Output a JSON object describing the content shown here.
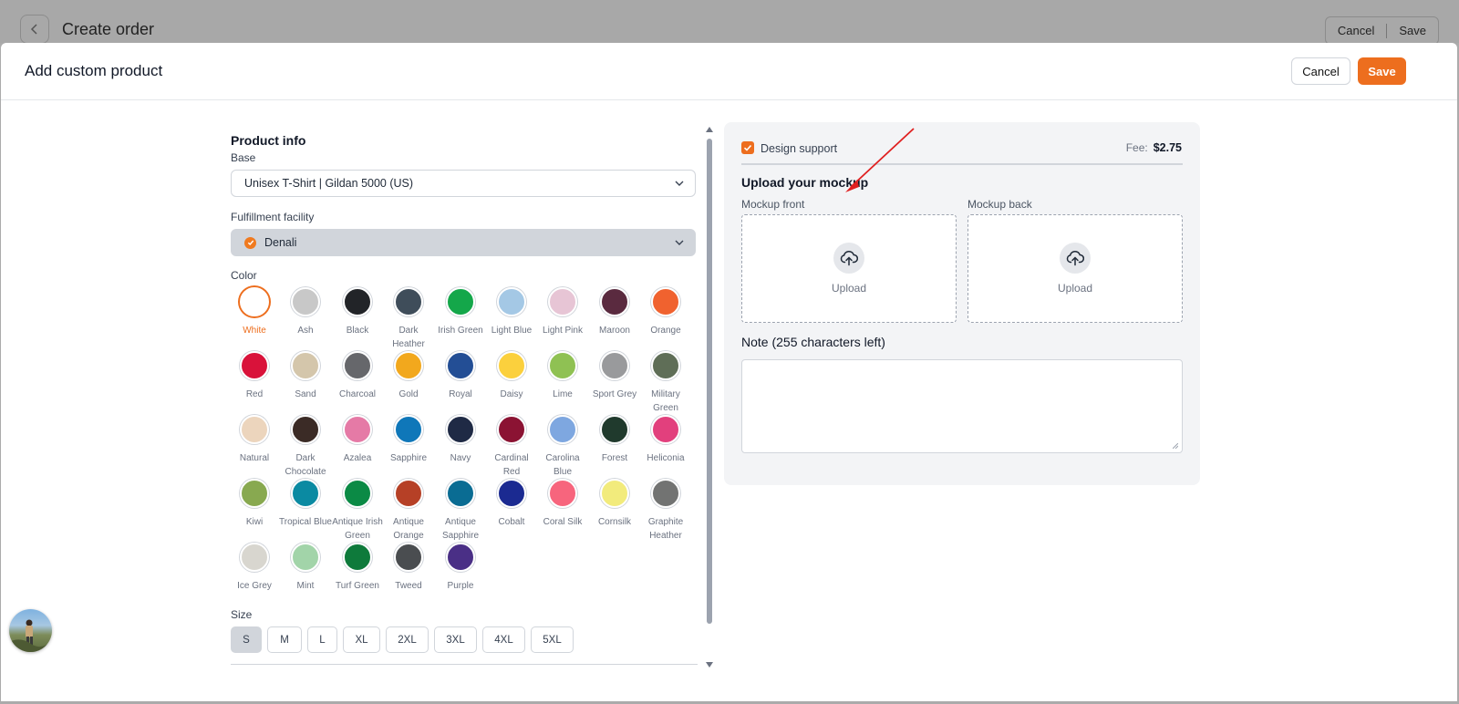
{
  "background": {
    "title": "Create order",
    "cancel_label": "Cancel",
    "save_label": "Save"
  },
  "modal": {
    "title": "Add custom product",
    "cancel_label": "Cancel",
    "save_label": "Save"
  },
  "product_info": {
    "section_title": "Product info",
    "base_label": "Base",
    "base_value": "Unisex T-Shirt | Gildan 5000 (US)",
    "facility_label": "Fulfillment facility",
    "facility_value": "Denali",
    "color_label": "Color",
    "colors": [
      {
        "name": "White",
        "hex": "#ffffff",
        "selected": true
      },
      {
        "name": "Ash",
        "hex": "#c8c8c8"
      },
      {
        "name": "Black",
        "hex": "#222428"
      },
      {
        "name": "Dark Heather",
        "hex": "#3f4d5a"
      },
      {
        "name": "Irish Green",
        "hex": "#14a74a"
      },
      {
        "name": "Light Blue",
        "hex": "#a4c8e5"
      },
      {
        "name": "Light Pink",
        "hex": "#e7c5d5"
      },
      {
        "name": "Maroon",
        "hex": "#5a2a3f"
      },
      {
        "name": "Orange",
        "hex": "#f0622f"
      },
      {
        "name": "Red",
        "hex": "#d9123a"
      },
      {
        "name": "Sand",
        "hex": "#d4c6ab"
      },
      {
        "name": "Charcoal",
        "hex": "#66676b"
      },
      {
        "name": "Gold",
        "hex": "#f2a81d"
      },
      {
        "name": "Royal",
        "hex": "#234e95"
      },
      {
        "name": "Daisy",
        "hex": "#fbd03d"
      },
      {
        "name": "Lime",
        "hex": "#8fc153"
      },
      {
        "name": "Sport Grey",
        "hex": "#999a9c"
      },
      {
        "name": "Military Green",
        "hex": "#5f6e57"
      },
      {
        "name": "Natural",
        "hex": "#ecd5bd"
      },
      {
        "name": "Dark Chocolate",
        "hex": "#3b2b26"
      },
      {
        "name": "Azalea",
        "hex": "#e57aa6"
      },
      {
        "name": "Sapphire",
        "hex": "#0f77b9"
      },
      {
        "name": "Navy",
        "hex": "#1f2a45"
      },
      {
        "name": "Cardinal Red",
        "hex": "#8b1333"
      },
      {
        "name": "Carolina Blue",
        "hex": "#7ea7e0"
      },
      {
        "name": "Forest",
        "hex": "#203a2d"
      },
      {
        "name": "Heliconia",
        "hex": "#e2407d"
      },
      {
        "name": "Kiwi",
        "hex": "#88a950"
      },
      {
        "name": "Tropical Blue",
        "hex": "#0b8aa2"
      },
      {
        "name": "Antique Irish Green",
        "hex": "#0b8a45"
      },
      {
        "name": "Antique Orange",
        "hex": "#b64026"
      },
      {
        "name": "Antique Sapphire",
        "hex": "#0a6c93"
      },
      {
        "name": "Cobalt",
        "hex": "#1b2a91"
      },
      {
        "name": "Coral Silk",
        "hex": "#f7657d"
      },
      {
        "name": "Cornsilk",
        "hex": "#f2eb7c"
      },
      {
        "name": "Graphite Heather",
        "hex": "#727372"
      },
      {
        "name": "Ice Grey",
        "hex": "#d8d6cf"
      },
      {
        "name": "Mint",
        "hex": "#a2d4a9"
      },
      {
        "name": "Turf Green",
        "hex": "#0e7a3b"
      },
      {
        "name": "Tweed",
        "hex": "#4a4d50"
      },
      {
        "name": "Purple",
        "hex": "#4a2f86"
      }
    ],
    "size_label": "Size",
    "sizes": [
      "S",
      "M",
      "L",
      "XL",
      "2XL",
      "3XL",
      "4XL",
      "5XL"
    ],
    "selected_size": "S"
  },
  "design": {
    "support_label": "Design support",
    "support_checked": true,
    "fee_label": "Fee:",
    "fee_value": "$2.75",
    "upload_title": "Upload your mockup",
    "front_label": "Mockup front",
    "back_label": "Mockup back",
    "upload_label": "Upload",
    "note_title": "Note (255 characters left)"
  },
  "colors": {
    "accent": "#ed6e1e"
  }
}
